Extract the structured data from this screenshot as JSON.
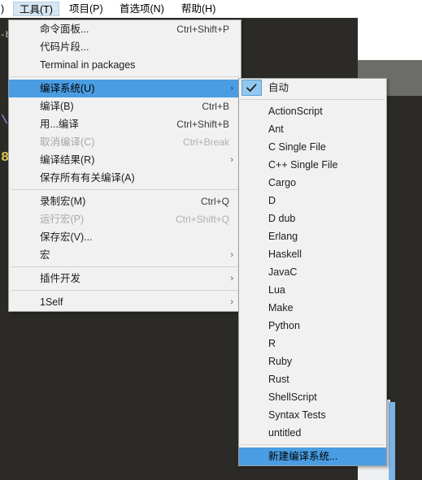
{
  "menubar": {
    "partial_item": ")",
    "items": [
      {
        "label": "工具(T)",
        "active": true
      },
      {
        "label": "项目(P)",
        "active": false
      },
      {
        "label": "首选项(N)",
        "active": false
      },
      {
        "label": "帮助(H)",
        "active": false
      }
    ]
  },
  "editor": {
    "gutter_glyph_1": "-b",
    "code_glyph_1": "\\",
    "code_glyph_2": "8"
  },
  "tools_menu": {
    "items": [
      {
        "label": "命令面板...",
        "accel": "Ctrl+Shift+P",
        "disabled": false,
        "submenu": false,
        "highlighted": false
      },
      {
        "label": "代码片段...",
        "accel": "",
        "disabled": false,
        "submenu": false,
        "highlighted": false
      },
      {
        "label": "Terminal in packages",
        "accel": "",
        "disabled": false,
        "submenu": false,
        "highlighted": false
      },
      {
        "separator": true
      },
      {
        "label": "编译系统(U)",
        "accel": "",
        "disabled": false,
        "submenu": true,
        "highlighted": true
      },
      {
        "label": "编译(B)",
        "accel": "Ctrl+B",
        "disabled": false,
        "submenu": false,
        "highlighted": false
      },
      {
        "label": "用...编译",
        "accel": "Ctrl+Shift+B",
        "disabled": false,
        "submenu": false,
        "highlighted": false
      },
      {
        "label": "取消编译(C)",
        "accel": "Ctrl+Break",
        "disabled": true,
        "submenu": false,
        "highlighted": false
      },
      {
        "label": "编译结果(R)",
        "accel": "",
        "disabled": false,
        "submenu": true,
        "highlighted": false
      },
      {
        "label": "保存所有有关编译(A)",
        "accel": "",
        "disabled": false,
        "submenu": false,
        "highlighted": false
      },
      {
        "separator": true
      },
      {
        "label": "录制宏(M)",
        "accel": "Ctrl+Q",
        "disabled": false,
        "submenu": false,
        "highlighted": false
      },
      {
        "label": "运行宏(P)",
        "accel": "Ctrl+Shift+Q",
        "disabled": true,
        "submenu": false,
        "highlighted": false
      },
      {
        "label": "保存宏(V)...",
        "accel": "",
        "disabled": false,
        "submenu": false,
        "highlighted": false
      },
      {
        "label": "宏",
        "accel": "",
        "disabled": false,
        "submenu": true,
        "highlighted": false
      },
      {
        "separator": true
      },
      {
        "label": "插件开发",
        "accel": "",
        "disabled": false,
        "submenu": true,
        "highlighted": false
      },
      {
        "separator": true
      },
      {
        "label": "1Self",
        "accel": "",
        "disabled": false,
        "submenu": true,
        "highlighted": false
      }
    ]
  },
  "build_system_submenu": {
    "items": [
      {
        "label": "自动",
        "checked": true,
        "highlighted": false
      },
      {
        "separator": true
      },
      {
        "label": "ActionScript",
        "checked": false,
        "highlighted": false
      },
      {
        "label": "Ant",
        "checked": false,
        "highlighted": false
      },
      {
        "label": "C Single File",
        "checked": false,
        "highlighted": false
      },
      {
        "label": "C++ Single File",
        "checked": false,
        "highlighted": false
      },
      {
        "label": "Cargo",
        "checked": false,
        "highlighted": false
      },
      {
        "label": "D",
        "checked": false,
        "highlighted": false
      },
      {
        "label": "D dub",
        "checked": false,
        "highlighted": false
      },
      {
        "label": "Erlang",
        "checked": false,
        "highlighted": false
      },
      {
        "label": "Haskell",
        "checked": false,
        "highlighted": false
      },
      {
        "label": "JavaC",
        "checked": false,
        "highlighted": false
      },
      {
        "label": "Lua",
        "checked": false,
        "highlighted": false
      },
      {
        "label": "Make",
        "checked": false,
        "highlighted": false
      },
      {
        "label": "Python",
        "checked": false,
        "highlighted": false
      },
      {
        "label": "R",
        "checked": false,
        "highlighted": false
      },
      {
        "label": "Ruby",
        "checked": false,
        "highlighted": false
      },
      {
        "label": "Rust",
        "checked": false,
        "highlighted": false
      },
      {
        "label": "ShellScript",
        "checked": false,
        "highlighted": false
      },
      {
        "label": "Syntax Tests",
        "checked": false,
        "highlighted": false
      },
      {
        "label": "untitled",
        "checked": false,
        "highlighted": false
      },
      {
        "separator": true
      },
      {
        "label": "新建编译系统...",
        "checked": false,
        "highlighted": true
      }
    ]
  },
  "colors": {
    "highlight_blue": "#4a9de2",
    "menu_bg": "#f1f1f1",
    "editor_bg": "#2b2a26",
    "menubar_active": "#d8e6f2"
  }
}
